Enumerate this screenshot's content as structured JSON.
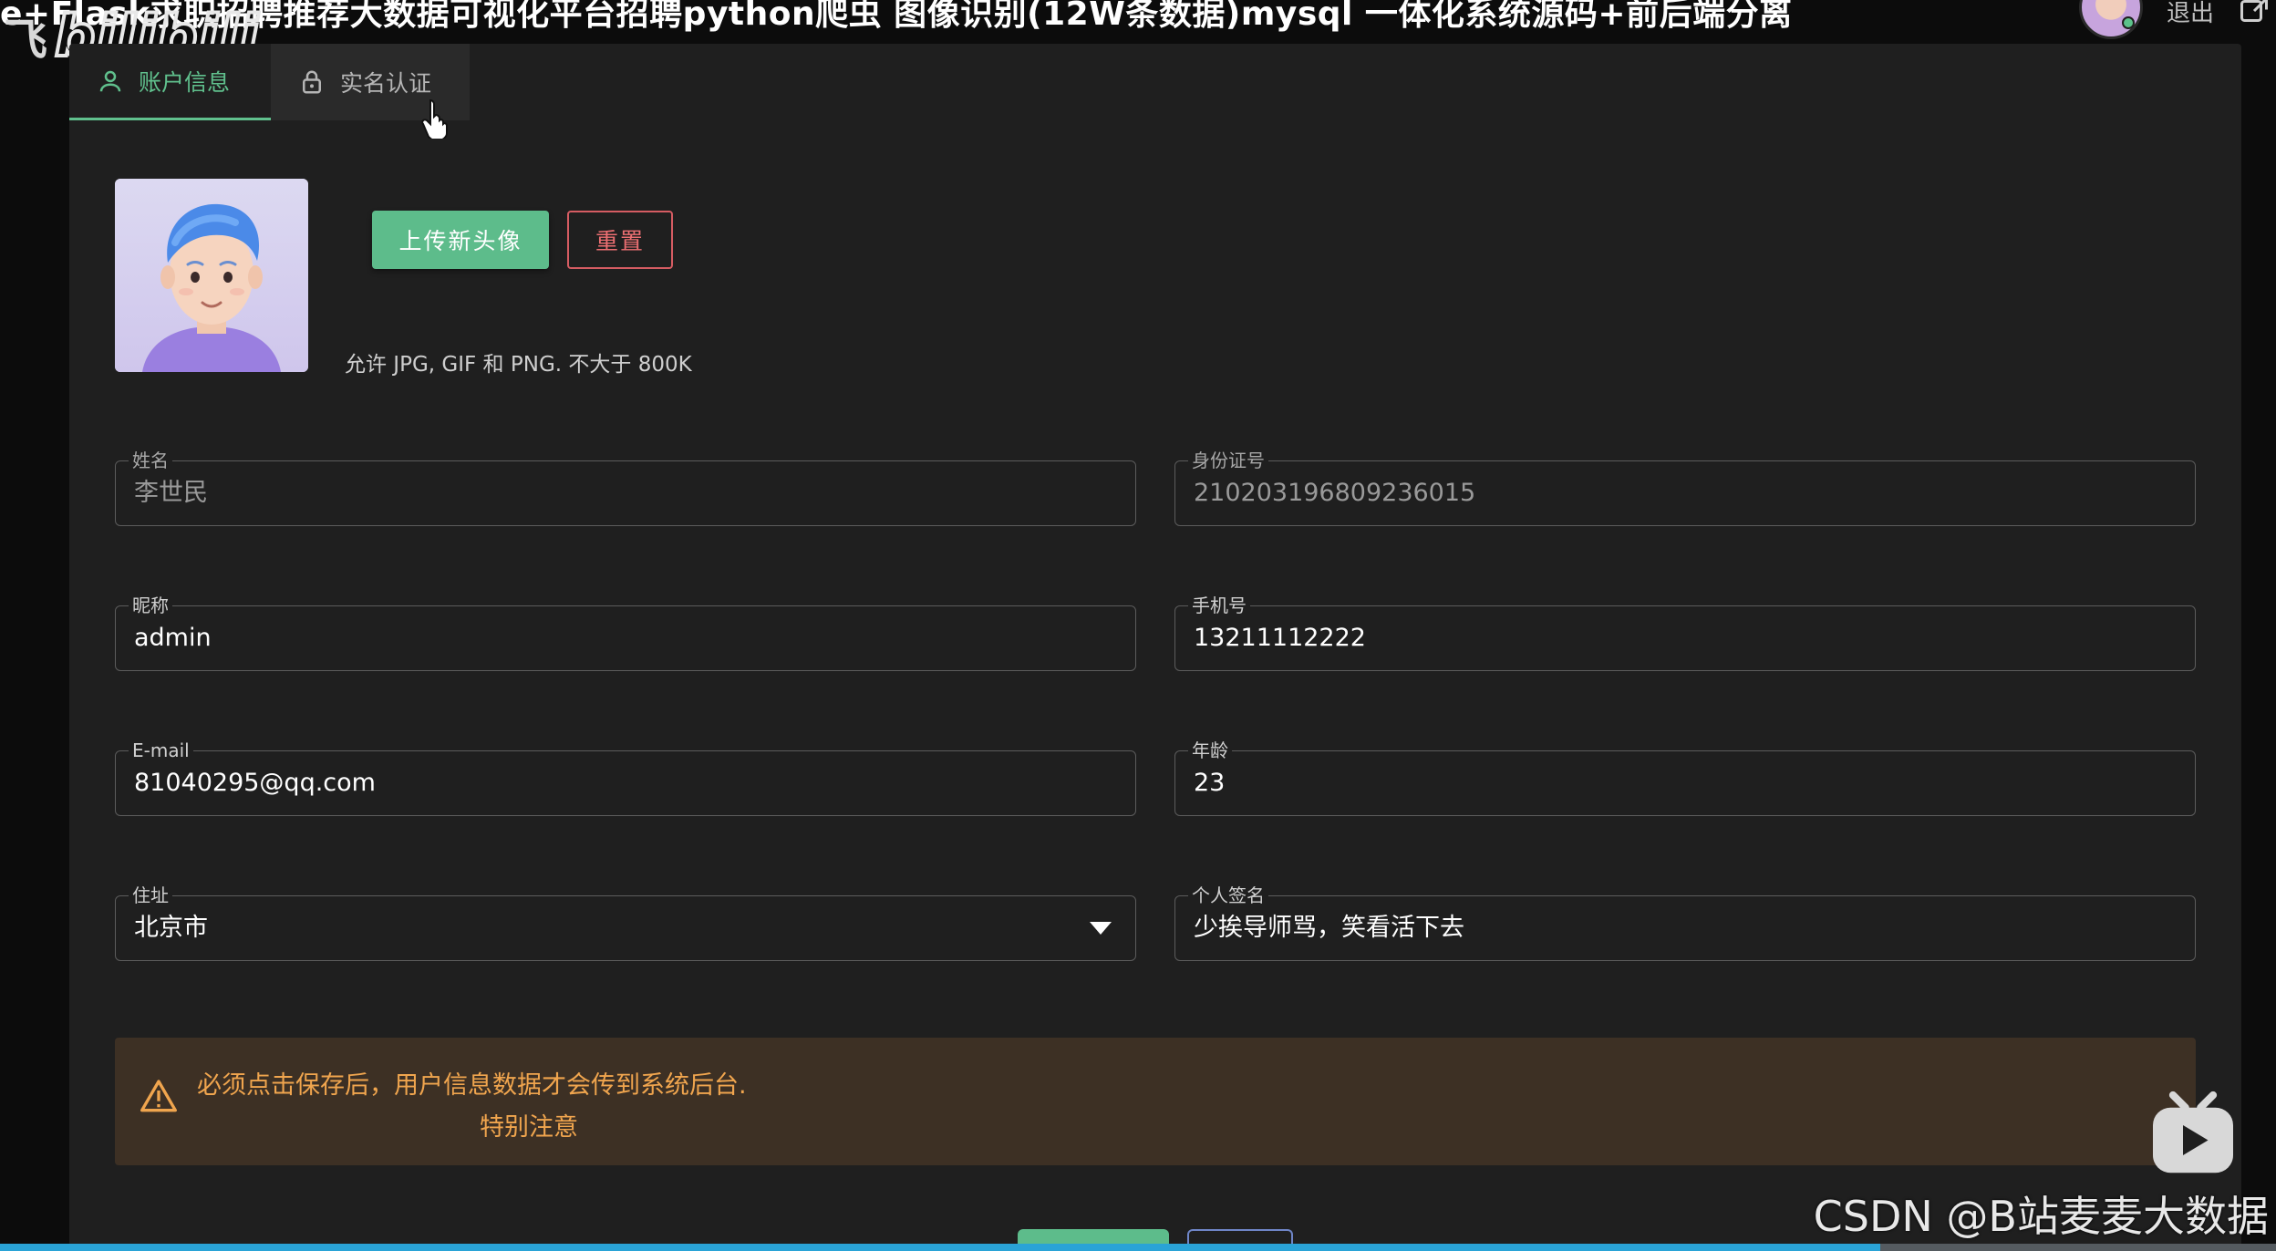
{
  "video": {
    "title": "e+Flask求职招聘推荐大数据可视化平台招聘python爬虫 图像识别(12W条数据)mysql 一体化系统源码+前后端分离",
    "logo_prefix": "飞",
    "logo_text": "bilibili",
    "logout_label": "退出",
    "watermark": "CSDN @B站麦麦大数据",
    "progress": 0.826
  },
  "tabs": [
    {
      "label": "账户信息",
      "icon": "user-icon",
      "active": true
    },
    {
      "label": "实名认证",
      "icon": "lock-icon",
      "active": false
    }
  ],
  "avatar": {
    "upload_label": "上传新头像",
    "reset_label": "重置",
    "hint": "允许 JPG, GIF 和 PNG. 不大于 800K"
  },
  "fields": {
    "name": {
      "label": "姓名",
      "value": "李世民",
      "disabled": true
    },
    "id_number": {
      "label": "身份证号",
      "value": "210203196809236015",
      "disabled": true
    },
    "nickname": {
      "label": "昵称",
      "value": "admin"
    },
    "phone": {
      "label": "手机号",
      "value": "13211112222"
    },
    "email": {
      "label": "E-mail",
      "value": "81040295@qq.com"
    },
    "age": {
      "label": "年龄",
      "value": "23"
    },
    "address": {
      "label": "住址",
      "value": "北京市"
    },
    "signature": {
      "label": "个人签名",
      "value": "少挨导师骂，笑看活下去"
    }
  },
  "alert": {
    "message": "必须点击保存后，用户信息数据才会传到系统后台.",
    "note": "特别注意"
  },
  "colors": {
    "accent": "#5dbc8b",
    "danger": "#d55c62",
    "warning_text": "#f0a54e",
    "warning_bg": "#3d3024",
    "panel_bg": "#1f1f1f"
  }
}
